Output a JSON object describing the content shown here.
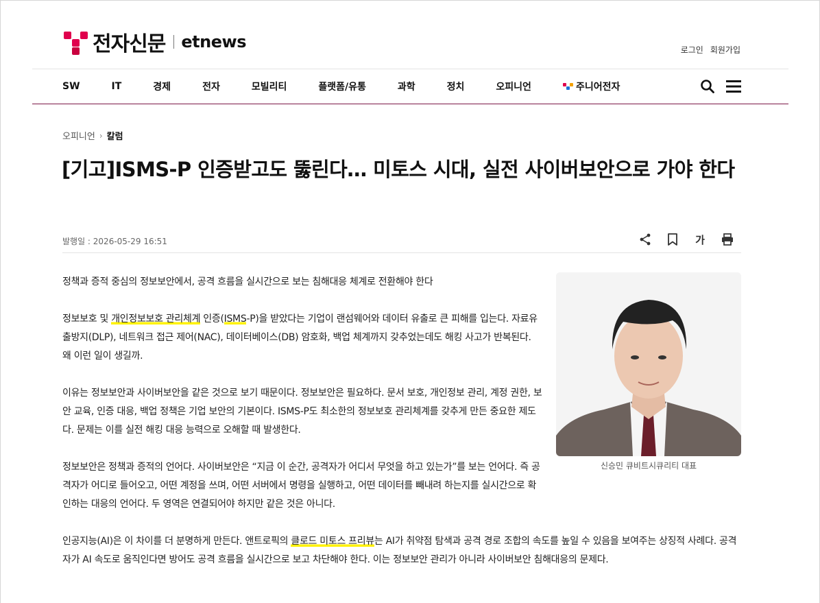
{
  "header": {
    "logo_ko": "전자신문",
    "logo_en": "etnews",
    "login": "로그인",
    "signup": "회원가입"
  },
  "nav": {
    "items": [
      "SW",
      "IT",
      "경제",
      "전자",
      "모빌리티",
      "플랫폼/유통",
      "과학",
      "정치",
      "오피니언"
    ],
    "junior": "주니어전자"
  },
  "breadcrumb": {
    "parent": "오피니언",
    "current": "칼럼"
  },
  "article": {
    "title": "[기고]ISMS-P 인증받고도 뚫린다… 미토스 시대, 실전 사이버보안으로 가야 한다",
    "published": "발행일 : 2026-05-29 16:51",
    "text_size_label": "가",
    "lead": "정책과 증적 중심의 정보보안에서, 공격 흐름을 실시간으로 보는 침해대응 체계로 전환해야 한다",
    "p1_a": "정보보호 및 ",
    "p1_hl1": "개인정보보호 관리체계",
    "p1_b": " 인증(",
    "p1_hl2": "ISMS",
    "p1_c": "-P)을 받았다는 기업이 랜섬웨어와 데이터 유출로 큰 피해를 입는다. 자료유출방지(DLP), 네트워크 접근 제어(NAC), 데이터베이스(DB) 암호화, 백업 체계까지 갖추었는데도 해킹 사고가 반복된다. 왜 이런 일이 생길까.",
    "p2": "이유는 정보보안과 사이버보안을 같은 것으로 보기 때문이다. 정보보안은 필요하다. 문서 보호, 개인정보 관리, 계정 권한, 보안 교육, 인증 대응, 백업 정책은 기업 보안의 기본이다. ISMS-P도 최소한의 정보보호 관리체계를 갖추게 만든 중요한 제도다. 문제는 이를 실전 해킹 대응 능력으로 오해할 때 발생한다.",
    "p3": "정보보안은 정책과 증적의 언어다. 사이버보안은 “지금 이 순간, 공격자가 어디서 무엇을 하고 있는가”를 보는 언어다. 즉 공격자가 어디로 들어오고, 어떤 계정을 쓰며, 어떤 서버에서 명령을 실행하고, 어떤 데이터를 빼내려 하는지를 실시간으로 확인하는 대응의 언어다. 두 영역은 연결되어야 하지만 같은 것은 아니다.",
    "p4_a": "인공지능(AI)은 이 차이를 더 분명하게 만든다. 앤트로픽의 ",
    "p4_hl": "클로드 미토스 프리뷰",
    "p4_b": "는 AI가 취약점 탐색과 공격 경로 조합의 속도를 높일 수 있음을 보여주는 상징적 사례다. 공격자가 AI 속도로 움직인다면 방어도 공격 흐름을 실시간으로 보고 차단해야 한다. 이는 정보보안 관리가 아니라 사이버보안 침해대응의 문제다.",
    "photo_caption": "신승민 큐비트시큐리티 대표"
  },
  "colors": {
    "brand": "#e0004d",
    "nav_border": "#7a1545",
    "highlight": "#fff200"
  }
}
